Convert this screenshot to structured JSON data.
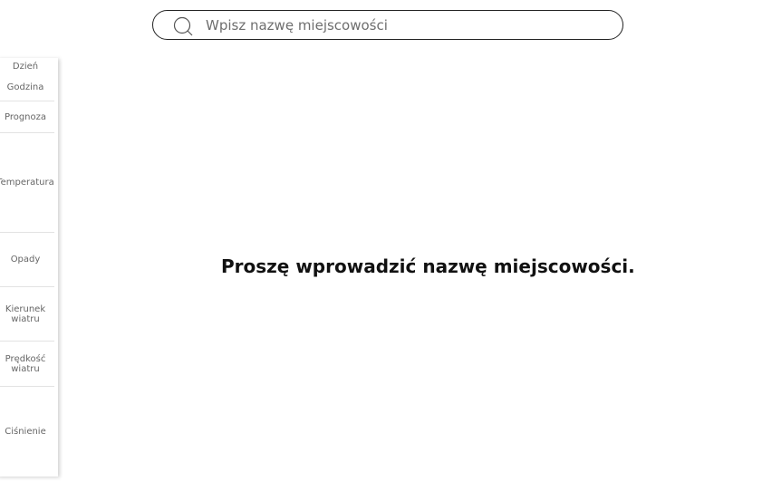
{
  "search": {
    "placeholder": "Wpisz nazwę miejscowości",
    "icon": "search-icon"
  },
  "sidebar": {
    "rows": [
      {
        "label": "Dzień"
      },
      {
        "label": "Godzina"
      },
      {
        "label": "Prognoza"
      },
      {
        "label": "Temperatura"
      },
      {
        "label": "Opady"
      },
      {
        "label": "Kierunek\nwiatru"
      },
      {
        "label": "Prędkość\nwiatru"
      },
      {
        "label": "Ciśnienie"
      }
    ]
  },
  "main": {
    "message": "Proszę wprowadzić nazwę miejscowości."
  }
}
